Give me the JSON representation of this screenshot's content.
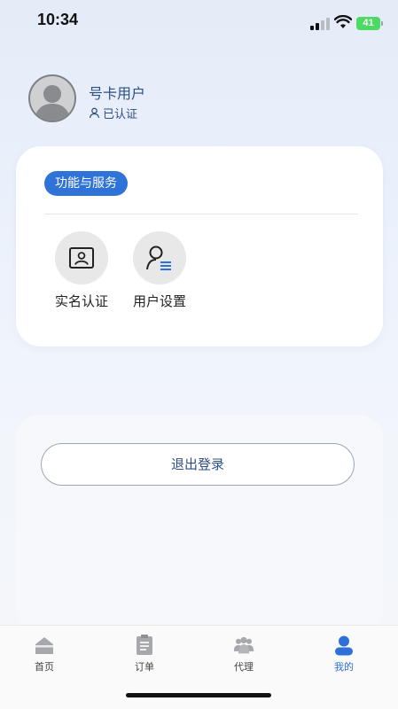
{
  "status_bar": {
    "time": "10:34",
    "battery": "41"
  },
  "profile": {
    "username": "号卡用户",
    "verified_label": "已认证"
  },
  "services": {
    "badge": "功能与服务",
    "items": [
      {
        "label": "实名认证",
        "icon": "id-card-icon"
      },
      {
        "label": "用户设置",
        "icon": "user-settings-icon"
      }
    ]
  },
  "logout": {
    "label": "退出登录"
  },
  "tabbar": {
    "active_color": "#2f6fd8",
    "items": [
      {
        "label": "首页",
        "icon": "home-icon"
      },
      {
        "label": "订单",
        "icon": "order-icon"
      },
      {
        "label": "代理",
        "icon": "agent-icon"
      },
      {
        "label": "我的",
        "icon": "profile-icon",
        "active": true
      }
    ]
  }
}
